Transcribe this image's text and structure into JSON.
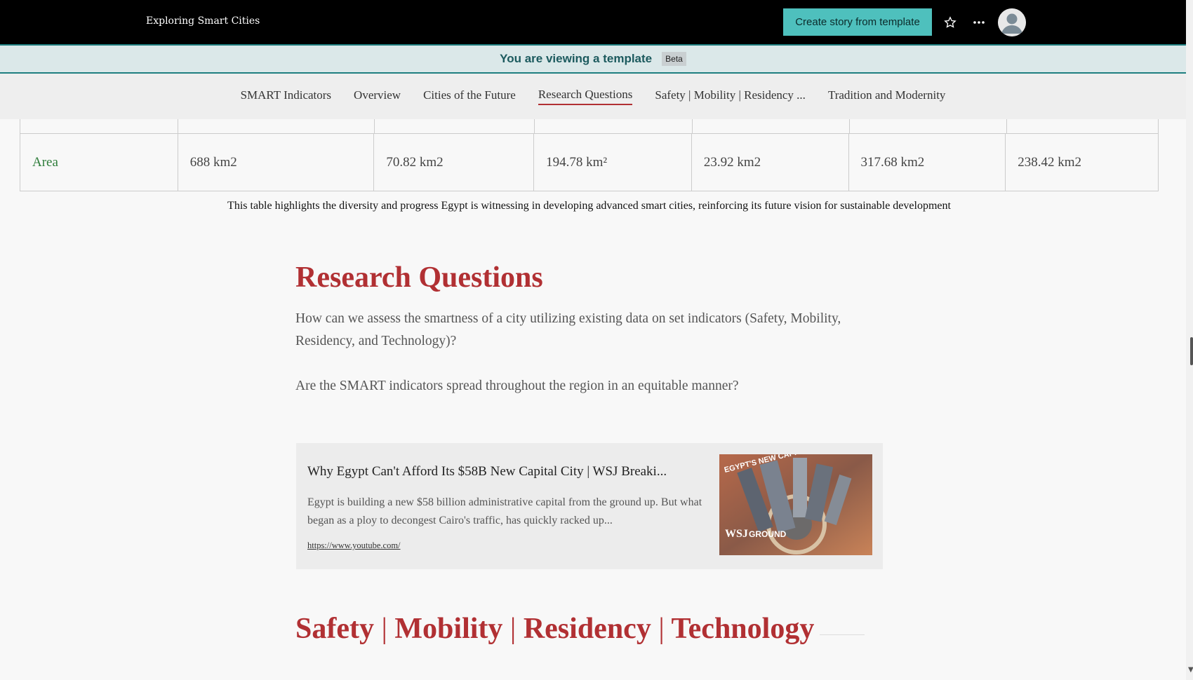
{
  "header": {
    "app_title": "Exploring Smart Cities",
    "create_button": "Create story from template",
    "star_icon": "star-icon",
    "more_icon": "more-icon",
    "avatar_icon": "user-avatar-icon"
  },
  "banner": {
    "text": "You are viewing a template",
    "badge": "Beta"
  },
  "nav": {
    "items": [
      "SMART Indicators",
      "Overview",
      "Cities of the Future",
      "Research Questions",
      "Safety | Mobility | Residency ...",
      "Tradition and Modernity"
    ],
    "active": "Research Questions"
  },
  "table": {
    "row_label": "Area",
    "values": [
      "688 km2",
      "70.82 km2",
      "194.78 km²",
      "23.92 km2",
      "317.68 km2",
      "238.42 km2"
    ],
    "caption": "This table highlights the diversity and progress Egypt is witnessing in developing advanced smart cities, reinforcing its future vision for sustainable development"
  },
  "research": {
    "title": "Research Questions",
    "q1": "How can we assess the smartness of a city utilizing existing data on set indicators (Safety, Mobility, Residency, and Technology)?",
    "q2": "Are the SMART indicators spread throughout the region in an equitable manner?"
  },
  "embed": {
    "title": "Why Egypt Can't Afford Its $58B New Capital City | WSJ Breaki...",
    "description": "Egypt is building a new $58 billion administrative capital from the ground up. But what began as a ploy to decongest Cairo's traffic, has quickly racked up...",
    "url": "https://www.youtube.com/",
    "thumb_top_text": "EGYPT'S NEW CAPITAL",
    "thumb_logo": "WSJ",
    "thumb_series": "GROUND"
  },
  "section2": {
    "safety": "Safety",
    "mobility": "Mobility",
    "residency": "Residency",
    "technology": "Technology",
    "separator": "|"
  },
  "colors": {
    "accent": "#b13033",
    "teal_button": "#4ec0bd",
    "banner_bg": "#dbe8e9",
    "row_label": "#2e7d3a"
  }
}
